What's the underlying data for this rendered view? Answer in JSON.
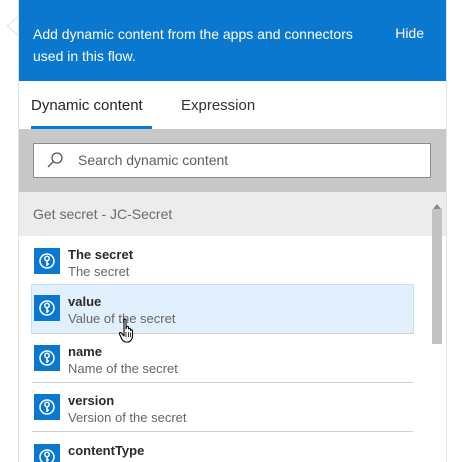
{
  "banner": {
    "text": "Add dynamic content from the apps and connectors used in this flow.",
    "hide_label": "Hide"
  },
  "tabs": [
    {
      "label": "Dynamic content",
      "active": true
    },
    {
      "label": "Expression",
      "active": false
    }
  ],
  "search": {
    "placeholder": "Search dynamic content"
  },
  "section": {
    "title": "Get secret - JC-Secret"
  },
  "items": [
    {
      "name": "The secret",
      "description": "The secret"
    },
    {
      "name": "value",
      "description": "Value of the secret"
    },
    {
      "name": "name",
      "description": "Name of the secret"
    },
    {
      "name": "version",
      "description": "Version of the secret"
    },
    {
      "name": "contentType",
      "description": ""
    }
  ],
  "icons": {
    "item_icon": "key-vault-icon",
    "search_icon": "search-icon",
    "cursor": "hand-pointer-cursor"
  },
  "colors": {
    "accent": "#0b78d0",
    "highlight": "#e2effc"
  }
}
